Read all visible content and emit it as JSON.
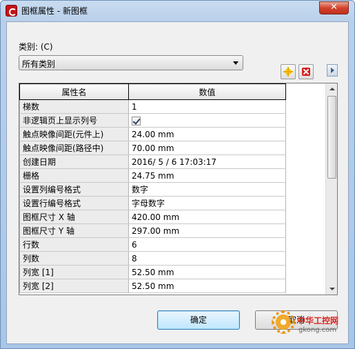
{
  "window": {
    "title": "图框属性 - 新图框",
    "close_glyph": "✕"
  },
  "category": {
    "label": "类别: (C)",
    "selected": "所有类别"
  },
  "toolbar": {
    "new_icon": "new-star-icon",
    "delete_icon": "delete-x-icon"
  },
  "table": {
    "headers": [
      "属性名",
      "数值"
    ],
    "rows": [
      {
        "name": "梯数",
        "value": "1"
      },
      {
        "name": "非逻辑页上显示列号",
        "value": "",
        "checked": true
      },
      {
        "name": "触点映像间距(元件上)",
        "value": "24.00 mm"
      },
      {
        "name": "触点映像间距(路径中)",
        "value": "70.00 mm"
      },
      {
        "name": "创建日期",
        "value": "2016/ 5 / 6  17:03:17"
      },
      {
        "name": "栅格",
        "value": "24.75 mm"
      },
      {
        "name": "设置列编号格式",
        "value": "数字"
      },
      {
        "name": "设置行编号格式",
        "value": "字母数字"
      },
      {
        "name": "图框尺寸 X 轴",
        "value": "420.00 mm"
      },
      {
        "name": "图框尺寸 Y 轴",
        "value": "297.00 mm"
      },
      {
        "name": "行数",
        "value": "6"
      },
      {
        "name": "列数",
        "value": "8"
      },
      {
        "name": "列宽 [1]",
        "value": "52.50 mm"
      },
      {
        "name": "列宽 [2]",
        "value": "52.50 mm"
      }
    ]
  },
  "buttons": {
    "ok": "确定",
    "cancel": "取消"
  },
  "watermark": {
    "text": "中华工控网",
    "sub": "gkong.com"
  }
}
